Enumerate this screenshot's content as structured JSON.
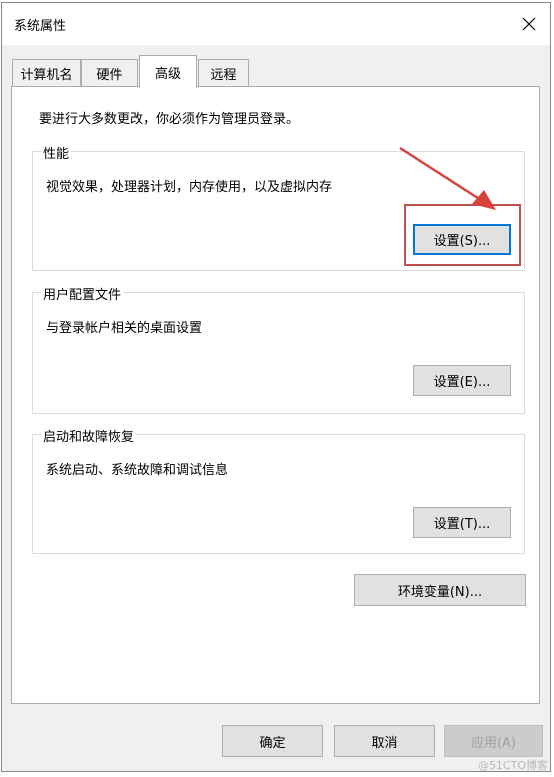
{
  "window": {
    "title": "系统属性"
  },
  "icons": {
    "close": "close-icon"
  },
  "tabs": [
    {
      "label": "计算机名"
    },
    {
      "label": "硬件"
    },
    {
      "label": "高级",
      "active": true
    },
    {
      "label": "远程"
    }
  ],
  "panel": {
    "admin_note": "要进行大多数更改，你必须作为管理员登录。",
    "performance": {
      "title": "性能",
      "description": "视觉效果，处理器计划，内存使用，以及虚拟内存",
      "button": "设置(S)..."
    },
    "user_profiles": {
      "title": "用户配置文件",
      "description": "与登录帐户相关的桌面设置",
      "button": "设置(E)..."
    },
    "startup_recovery": {
      "title": "启动和故障恢复",
      "description": "系统启动、系统故障和调试信息",
      "button": "设置(T)..."
    },
    "env_button": "环境变量(N)..."
  },
  "footer": {
    "ok": "确定",
    "cancel": "取消",
    "apply": "应用(A)"
  },
  "annotation": {
    "color": "#c0504d"
  },
  "watermark": "@51CTO博客"
}
